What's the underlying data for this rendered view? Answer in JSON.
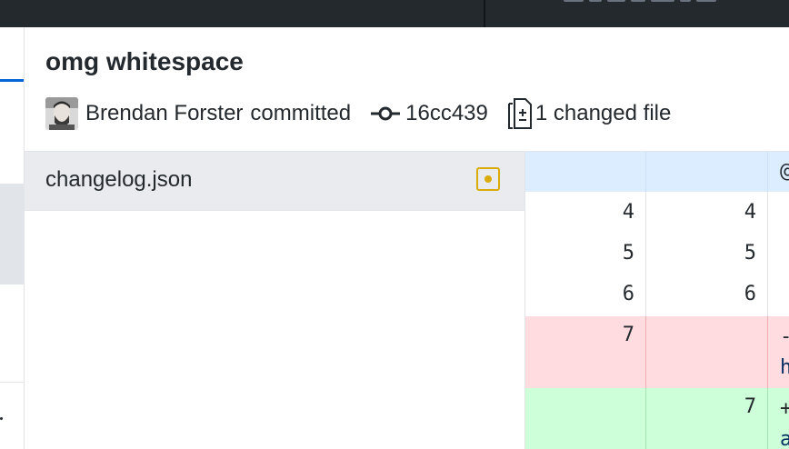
{
  "commit": {
    "title": "omg whitespace",
    "author": "Brendan Forster",
    "author_action": "committed",
    "sha": "16cc439",
    "changed_files": "1 changed file"
  },
  "files": [
    {
      "name": "changelog.json",
      "status": "modified"
    }
  ],
  "diff": {
    "hunk_code": "@",
    "lines": [
      {
        "old": "4",
        "new": "4",
        "type": "context",
        "code": ""
      },
      {
        "old": "5",
        "new": "5",
        "type": "context",
        "code": ""
      },
      {
        "old": "6",
        "new": "6",
        "type": "context",
        "code": ""
      },
      {
        "old": "7",
        "new": "",
        "type": "deleted",
        "code": "-",
        "code2": "h"
      },
      {
        "old": "",
        "new": "7",
        "type": "added",
        "code": "+",
        "code2": "a"
      }
    ]
  },
  "colors": {
    "toolbar": "#24292e",
    "accent": "#0366d6",
    "modified": "#dbab09",
    "hunk_bg": "#dbedff",
    "deleted_bg": "#ffdce0",
    "added_bg": "#cdffd8"
  },
  "icons": {
    "commit_sha": "git-commit-icon",
    "changed_files": "diff-file-icon",
    "file_status": "file-modified-icon"
  }
}
